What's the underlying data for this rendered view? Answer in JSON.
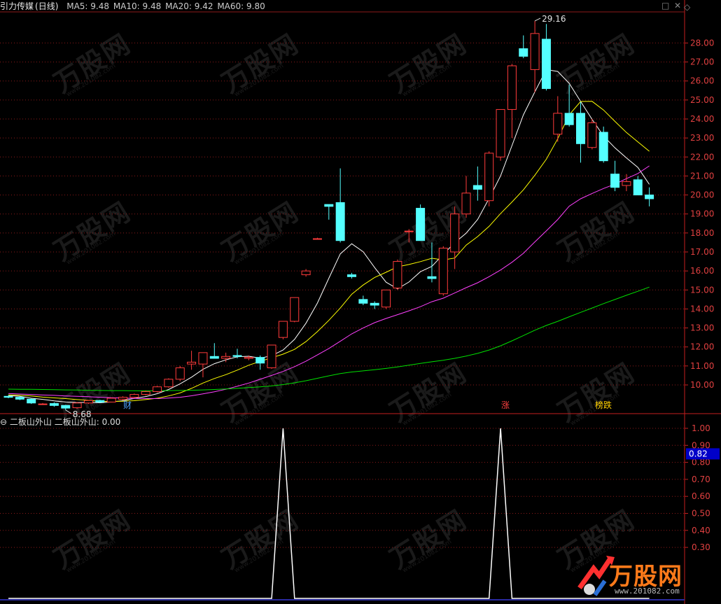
{
  "header": {
    "name": "引力传媒",
    "period": "(日线)",
    "ma": [
      {
        "label": "MA5: 9.48",
        "color": "#ffffff"
      },
      {
        "label": "MA10: 9.48",
        "color": "#ffff00"
      },
      {
        "label": "MA20: 9.42",
        "color": "#ff40ff"
      },
      {
        "label": "MA60: 9.80",
        "color": "#00e000"
      }
    ],
    "controls": {
      "max": "□",
      "close": "✕",
      "diamond": "◇"
    }
  },
  "indicator": {
    "title": "二板山外山",
    "value_label": "二板山外山: 0.00",
    "current_label": "0.82"
  },
  "markers": [
    {
      "text": "财",
      "color": "#4fa3ff"
    },
    {
      "text": "涨",
      "color": "#ff4040"
    },
    {
      "text": "榜跌",
      "color": "#ffd000"
    }
  ],
  "watermark": {
    "brand": "万股网",
    "url": "www.201082.com"
  },
  "logo": {
    "brand": "万股网",
    "url": "www.201082.com"
  },
  "colors": {
    "up": "#ff3b3b",
    "down": "#54ffff",
    "grid": "#8b1a1a",
    "axis": "#c41e1e"
  },
  "chart_data": [
    {
      "type": "candlestick",
      "title": "引力传媒 (日线)",
      "ylim": [
        8.6,
        29.6
      ],
      "yticks": [
        10,
        11,
        12,
        13,
        14,
        15,
        16,
        17,
        18,
        19,
        20,
        21,
        22,
        23,
        24,
        25,
        26,
        27,
        28
      ],
      "ytick_labels": [
        "10.00",
        "11.00",
        "12.00",
        "13.00",
        "14.00",
        "15.00",
        "16.00",
        "17.00",
        "18.00",
        "19.00",
        "20.00",
        "21.00",
        "22.00",
        "23.00",
        "24.00",
        "25.00",
        "26.00",
        "27.00",
        "28.00"
      ],
      "annotations": [
        {
          "text": "29.16",
          "type": "high"
        },
        {
          "text": "8.68",
          "type": "low"
        }
      ],
      "candles": [
        [
          9.4,
          9.45,
          9.3,
          9.35
        ],
        [
          9.35,
          9.4,
          9.2,
          9.25
        ],
        [
          9.25,
          9.3,
          9.0,
          9.05
        ],
        [
          9.0,
          9.05,
          8.95,
          9.0
        ],
        [
          9.02,
          9.08,
          8.85,
          8.92
        ],
        [
          8.92,
          8.95,
          8.68,
          8.78
        ],
        [
          8.8,
          9.1,
          8.75,
          9.05
        ],
        [
          9.05,
          9.2,
          9.0,
          9.18
        ],
        [
          9.18,
          9.22,
          9.05,
          9.1
        ],
        [
          9.1,
          9.35,
          9.08,
          9.3
        ],
        [
          9.25,
          9.4,
          9.2,
          9.35
        ],
        [
          9.35,
          9.55,
          9.3,
          9.5
        ],
        [
          9.5,
          9.7,
          9.45,
          9.65
        ],
        [
          9.65,
          9.95,
          9.6,
          9.9
        ],
        [
          9.9,
          10.35,
          9.85,
          10.3
        ],
        [
          10.3,
          11.0,
          10.2,
          10.9
        ],
        [
          11.1,
          11.8,
          10.8,
          11.2
        ],
        [
          11.1,
          11.6,
          10.4,
          11.7
        ],
        [
          11.5,
          12.2,
          11.4,
          11.4
        ],
        [
          11.4,
          11.7,
          11.2,
          11.5
        ],
        [
          11.55,
          11.9,
          11.4,
          11.5
        ],
        [
          11.4,
          11.55,
          11.3,
          11.45
        ],
        [
          11.45,
          11.55,
          10.8,
          11.15
        ],
        [
          10.9,
          12.0,
          10.85,
          12.1
        ],
        [
          12.5,
          13.35,
          12.4,
          13.35
        ],
        [
          13.35,
          14.6,
          13.3,
          14.6
        ],
        [
          15.8,
          16.1,
          15.7,
          16.0
        ],
        [
          17.7,
          17.75,
          17.7,
          17.7
        ],
        [
          19.5,
          19.5,
          18.7,
          19.4
        ],
        [
          19.6,
          21.4,
          17.5,
          17.6
        ],
        [
          15.8,
          15.9,
          15.6,
          15.7
        ],
        [
          14.5,
          14.7,
          14.2,
          14.3
        ],
        [
          14.3,
          14.4,
          14.0,
          14.2
        ],
        [
          14.1,
          15.0,
          14.0,
          15.0
        ],
        [
          15.1,
          16.6,
          15.0,
          16.5
        ],
        [
          18.1,
          18.2,
          17.5,
          18.1
        ],
        [
          19.3,
          19.5,
          17.6,
          17.6
        ],
        [
          15.7,
          17.5,
          15.4,
          15.6
        ],
        [
          14.8,
          17.3,
          14.7,
          17.2
        ],
        [
          17.0,
          19.4,
          16.1,
          19.0
        ],
        [
          19.0,
          21.0,
          18.8,
          20.1
        ],
        [
          20.5,
          21.5,
          19.7,
          20.3
        ],
        [
          19.7,
          22.3,
          19.4,
          22.2
        ],
        [
          22.0,
          24.5,
          21.8,
          24.5
        ],
        [
          24.5,
          26.9,
          23.0,
          26.8
        ],
        [
          27.7,
          28.4,
          27.2,
          27.3
        ],
        [
          26.6,
          29.16,
          25.4,
          28.5
        ],
        [
          28.2,
          29.0,
          25.5,
          25.6
        ],
        [
          23.2,
          25.2,
          22.8,
          24.3
        ],
        [
          24.3,
          25.8,
          23.6,
          23.7
        ],
        [
          24.3,
          24.9,
          21.7,
          22.7
        ],
        [
          22.5,
          24.0,
          22.4,
          23.8
        ],
        [
          23.3,
          23.6,
          21.7,
          21.8
        ],
        [
          21.1,
          21.8,
          20.2,
          20.4
        ],
        [
          20.5,
          21.1,
          20.2,
          20.7
        ],
        [
          20.8,
          21.0,
          20.0,
          20.0
        ],
        [
          20.0,
          20.4,
          19.4,
          19.8
        ]
      ],
      "ma": [
        {
          "name": "MA5",
          "color": "#ffffff",
          "values": [
            9.44,
            9.4,
            9.3,
            9.24,
            9.16,
            9.1,
            9.07,
            9.09,
            9.06,
            9.11,
            9.17,
            9.29,
            9.39,
            9.54,
            9.76,
            10.06,
            10.41,
            10.82,
            11.12,
            11.32,
            11.48,
            11.51,
            11.41,
            11.54,
            11.84,
            12.4,
            13.25,
            14.31,
            15.62,
            16.9,
            17.43,
            17.01,
            16.18,
            15.41,
            15.06,
            15.42,
            15.96,
            16.24,
            16.88,
            17.49,
            17.99,
            18.71,
            19.82,
            21.0,
            22.6,
            24.22,
            25.43,
            26.6,
            26.5,
            25.88,
            24.92,
            23.98,
            23.1,
            22.48,
            21.95,
            21.45,
            20.56
          ]
        },
        {
          "name": "MA10",
          "color": "#ffff00",
          "values": [
            9.48,
            9.46,
            9.42,
            9.36,
            9.32,
            9.28,
            9.23,
            9.19,
            9.14,
            9.13,
            9.14,
            9.17,
            9.23,
            9.3,
            9.42,
            9.58,
            9.82,
            10.1,
            10.34,
            10.54,
            10.78,
            11.04,
            11.24,
            11.43,
            11.62,
            11.87,
            12.28,
            12.81,
            13.4,
            14.05,
            14.78,
            15.26,
            15.66,
            15.93,
            16.22,
            16.34,
            16.49,
            16.67,
            16.58,
            16.68,
            17.36,
            17.81,
            18.35,
            19.02,
            19.63,
            20.27,
            21.04,
            21.88,
            22.96,
            24.22,
            24.92,
            24.93,
            24.47,
            23.87,
            23.29,
            22.79,
            22.3
          ]
        },
        {
          "name": "MA20",
          "color": "#ff40ff",
          "values": [
            9.55,
            9.52,
            9.5,
            9.47,
            9.45,
            9.42,
            9.4,
            9.38,
            9.35,
            9.33,
            9.31,
            9.29,
            9.28,
            9.28,
            9.31,
            9.35,
            9.43,
            9.53,
            9.64,
            9.77,
            9.93,
            10.1,
            10.3,
            10.5,
            10.71,
            10.96,
            11.25,
            11.58,
            11.92,
            12.3,
            12.69,
            13.0,
            13.28,
            13.5,
            13.7,
            13.9,
            14.12,
            14.38,
            14.57,
            14.84,
            15.12,
            15.38,
            15.7,
            16.05,
            16.46,
            16.93,
            17.53,
            18.11,
            18.71,
            19.41,
            19.8,
            20.08,
            20.34,
            20.57,
            20.86,
            21.13,
            21.53
          ]
        },
        {
          "name": "MA60",
          "color": "#00e000",
          "values": [
            9.78,
            9.77,
            9.77,
            9.76,
            9.75,
            9.74,
            9.73,
            9.72,
            9.71,
            9.7,
            9.7,
            9.69,
            9.69,
            9.69,
            9.7,
            9.71,
            9.72,
            9.74,
            9.76,
            9.79,
            9.82,
            9.86,
            9.9,
            9.95,
            10.02,
            10.11,
            10.22,
            10.35,
            10.48,
            10.6,
            10.68,
            10.74,
            10.8,
            10.87,
            10.95,
            11.04,
            11.13,
            11.22,
            11.3,
            11.4,
            11.52,
            11.66,
            11.84,
            12.06,
            12.32,
            12.6,
            12.88,
            13.13,
            13.35,
            13.59,
            13.82,
            14.05,
            14.28,
            14.5,
            14.72,
            14.93,
            15.15
          ]
        }
      ]
    },
    {
      "type": "line",
      "title": "二板山外山",
      "ylim": [
        0,
        1.1
      ],
      "yticks": [
        0.3,
        0.4,
        0.5,
        0.6,
        0.7,
        0.8,
        0.9,
        1.0
      ],
      "ytick_labels": [
        "0.30",
        "0.40",
        "0.50",
        "0.60",
        "0.70",
        "0.80",
        "0.90",
        "1.00"
      ],
      "series": [
        {
          "name": "二板山外山",
          "color": "#ffffff",
          "values": [
            0,
            0,
            0,
            0,
            0,
            0,
            0,
            0,
            0,
            0,
            0,
            0,
            0,
            0,
            0,
            0,
            0,
            0,
            0,
            0,
            0,
            0,
            0,
            0,
            1,
            0,
            0,
            0,
            0,
            0,
            0,
            0,
            0,
            0,
            0,
            0,
            0,
            0,
            0,
            0,
            0,
            0,
            0,
            1,
            0,
            0,
            0,
            0,
            0,
            0,
            0,
            0,
            0,
            0,
            0,
            0,
            0
          ]
        }
      ]
    }
  ]
}
